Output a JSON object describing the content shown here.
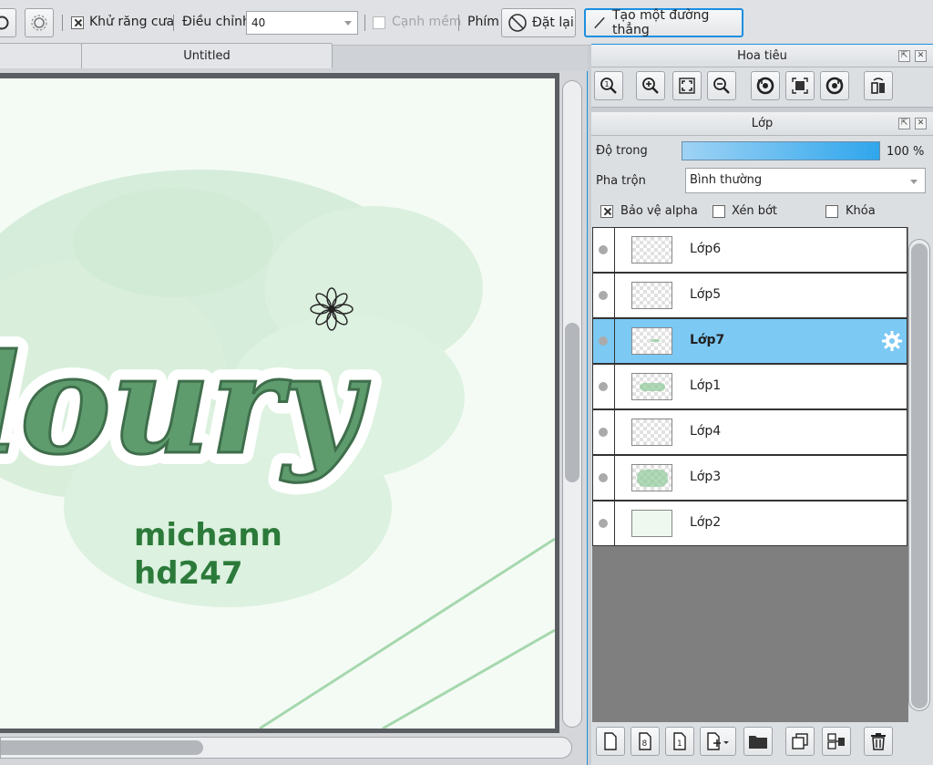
{
  "toolbar": {
    "antialias_label": "Khử răng cưa",
    "adjust_label": "Điều chỉnh",
    "adjust_value": "40",
    "soft_edge_label": "Cạnh mềm",
    "key_label": "Phím",
    "reset_label": "Đặt lại",
    "straight_line_label": "Tạo một đường thẳng"
  },
  "tabs": [
    {
      "label": ""
    },
    {
      "label": "Untitled"
    }
  ],
  "canvas": {
    "title_art": "loury",
    "credit_line1": "michann",
    "credit_line2": "hd247"
  },
  "navigator": {
    "title": "Hoa tiêu",
    "icons": [
      "actual-size-icon",
      "zoom-in-icon",
      "fit-icon",
      "zoom-out-icon",
      "rotate-left-icon",
      "reset-rotation-icon",
      "rotate-right-icon",
      "flip-icon"
    ]
  },
  "layers": {
    "title": "Lớp",
    "opacity_label": "Độ trong",
    "opacity_value": "100 %",
    "opacity_fraction": 1.0,
    "blend_label": "Pha trộn",
    "blend_value": "Bình thường",
    "protect_alpha_label": "Bảo vệ alpha",
    "protect_alpha_checked": true,
    "clipping_label": "Xén bớt",
    "lock_label": "Khóa",
    "items": [
      {
        "name": "Lớp6",
        "selected": false
      },
      {
        "name": "Lớp5",
        "selected": false
      },
      {
        "name": "Lớp7",
        "selected": true
      },
      {
        "name": "Lớp1",
        "selected": false
      },
      {
        "name": "Lớp4",
        "selected": false
      },
      {
        "name": "Lớp3",
        "selected": false
      },
      {
        "name": "Lớp2",
        "selected": false
      }
    ]
  },
  "colors": {
    "accent": "#1d8fe0",
    "selected_layer": "#7cc9f4",
    "text_green": "#2c7a3a"
  }
}
